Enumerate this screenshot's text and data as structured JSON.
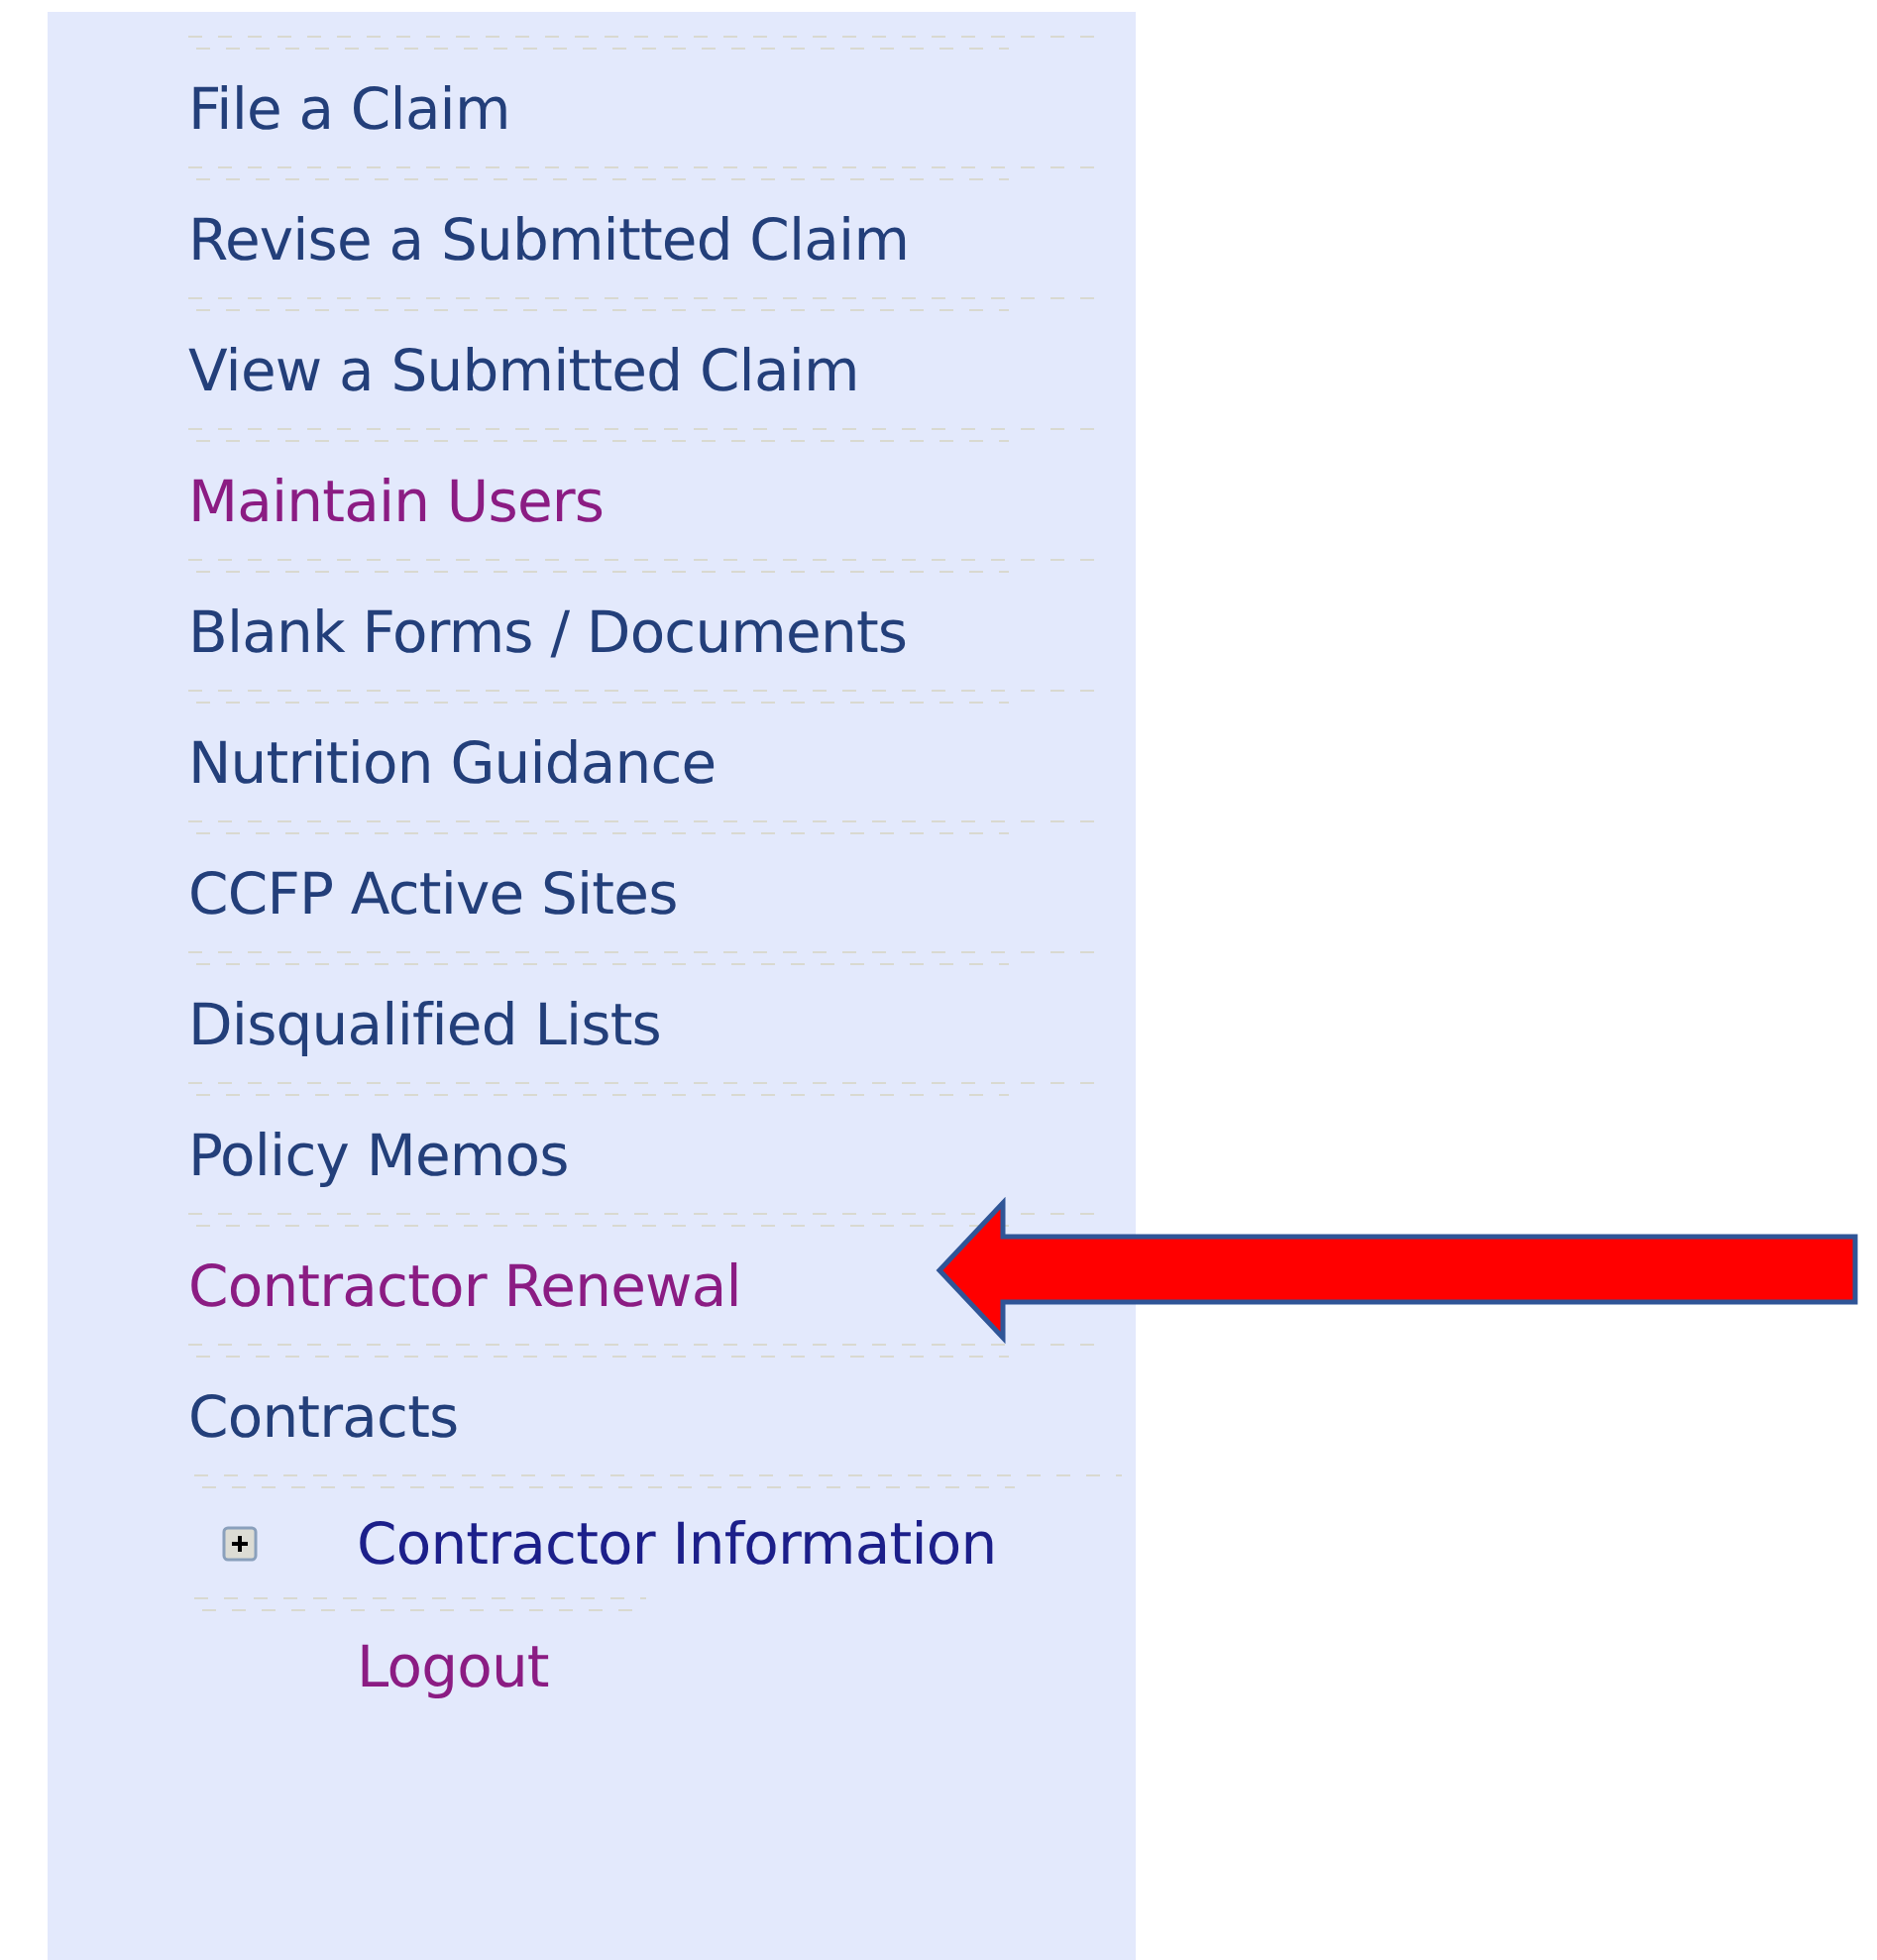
{
  "menu": {
    "items": [
      {
        "label": "File a Claim",
        "visited": false,
        "pointed": false
      },
      {
        "label": "Revise a Submitted Claim",
        "visited": false,
        "pointed": false
      },
      {
        "label": "View a Submitted Claim",
        "visited": false,
        "pointed": false
      },
      {
        "label": "Maintain Users",
        "visited": true,
        "pointed": false
      },
      {
        "label": "Blank Forms / Documents",
        "visited": false,
        "pointed": false
      },
      {
        "label": "Nutrition Guidance",
        "visited": false,
        "pointed": false
      },
      {
        "label": "CCFP Active Sites",
        "visited": false,
        "pointed": false
      },
      {
        "label": "Disqualified Lists",
        "visited": false,
        "pointed": false
      },
      {
        "label": "Policy Memos",
        "visited": false,
        "pointed": false
      },
      {
        "label": "Contractor Renewal",
        "visited": true,
        "pointed": true
      },
      {
        "label": "Contracts",
        "visited": false,
        "pointed": false,
        "children": [
          {
            "kind": "node",
            "label": "Contractor Information",
            "expanded": false,
            "visited": false
          },
          {
            "kind": "leaf",
            "label": "Logout",
            "visited": true
          }
        ]
      }
    ]
  }
}
